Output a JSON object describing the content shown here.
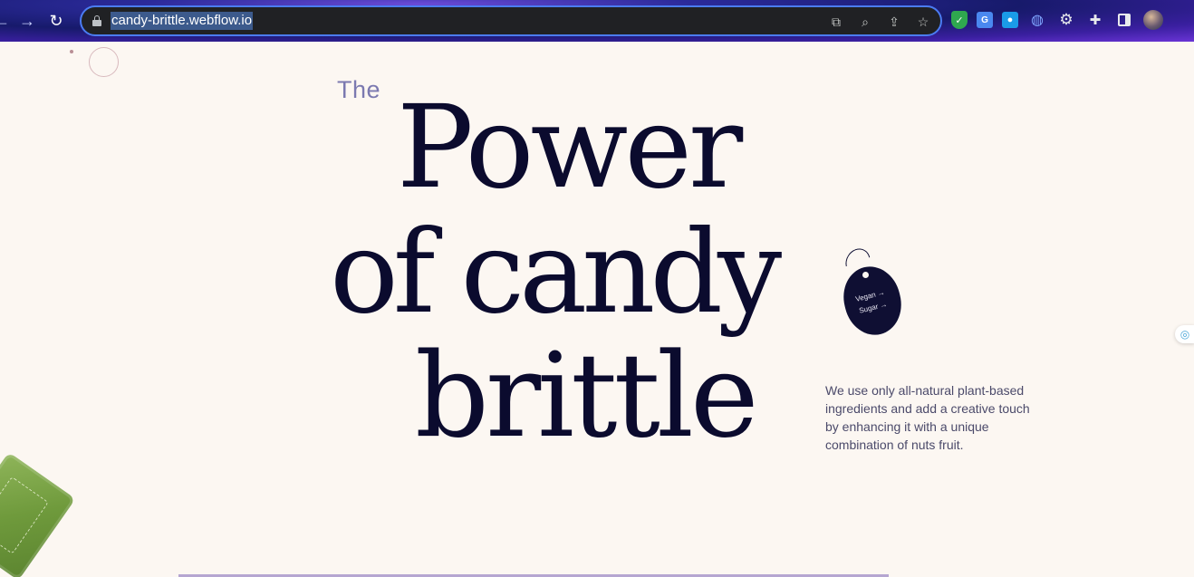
{
  "browser": {
    "url": "candy-brittle.webflow.io",
    "nav": {
      "back": "←",
      "forward": "→",
      "reload": "↻"
    },
    "omnibox_icons": [
      "translate-icon",
      "zoom-icon",
      "share-icon",
      "star-icon"
    ],
    "extensions": [
      "shield-extension-icon",
      "translate-extension-icon",
      "drop-extension-icon",
      "globe-extension-icon",
      "gear-extension-icon",
      "puzzle-icon",
      "side-panel-icon",
      "profile-avatar"
    ]
  },
  "hero": {
    "eyebrow": "The",
    "line1": "Power",
    "line2": "of candy",
    "line3": "brittle",
    "tag": {
      "text1": "Vegan →",
      "text2": "Sugar →"
    },
    "description": "We use only all-natural plant-based ingredients and add a creative touch by enhancing it with a unique combination of nuts fruit."
  },
  "colors": {
    "background": "#fcf7f2",
    "heading": "#0b0b2e",
    "eyebrow": "#7b79b0",
    "body_text": "#4b4a6a",
    "accent_border": "#4b7cf3"
  }
}
